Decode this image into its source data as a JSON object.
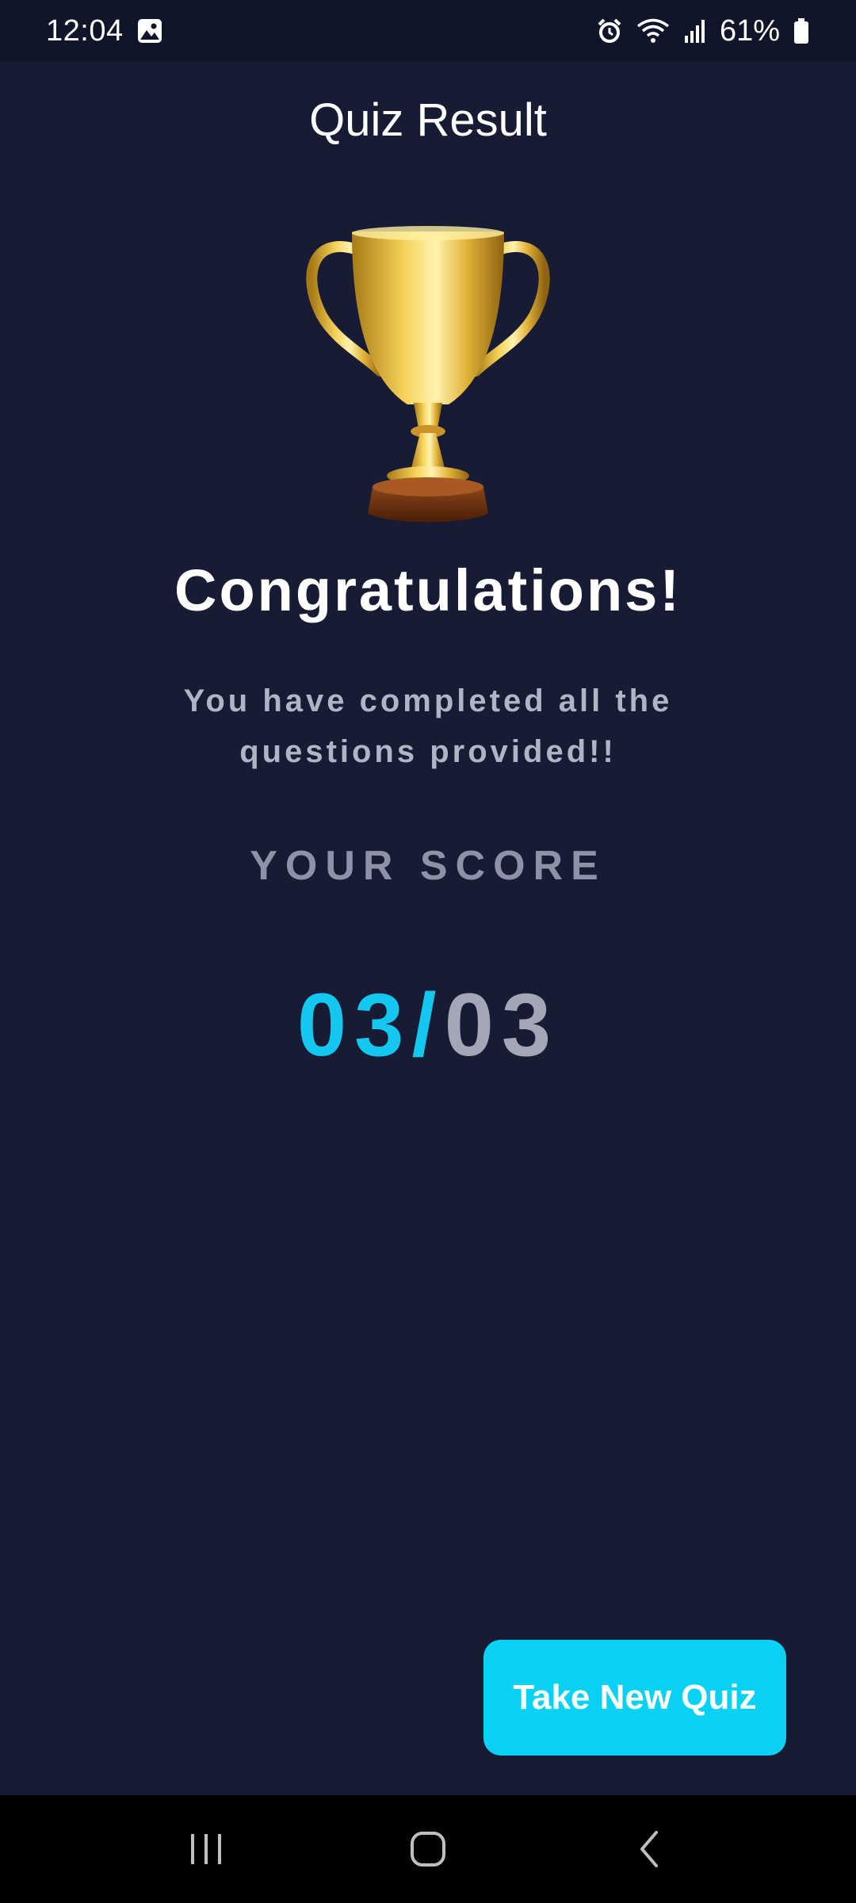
{
  "status_bar": {
    "time": "12:04",
    "battery_percent": "61%",
    "icons": [
      "image-icon",
      "alarm-icon",
      "wifi-icon",
      "signal-icon",
      "battery-icon"
    ]
  },
  "header": {
    "title": "Quiz Result"
  },
  "result": {
    "trophy_icon": "trophy-icon",
    "heading": "Congratulations!",
    "message": "You have completed all the questions provided!!",
    "score_label": "YOUR SCORE",
    "score_correct": "03",
    "score_separator": "/",
    "score_total": "03"
  },
  "actions": {
    "new_quiz_label": "Take New Quiz"
  },
  "nav_bar": {
    "icons": [
      "recent-apps-icon",
      "home-icon",
      "back-icon"
    ]
  },
  "colors": {
    "background": "#171b34",
    "accent": "#08d1f4",
    "score_accent": "#14c7ee",
    "muted_text": "#8f92a6"
  }
}
